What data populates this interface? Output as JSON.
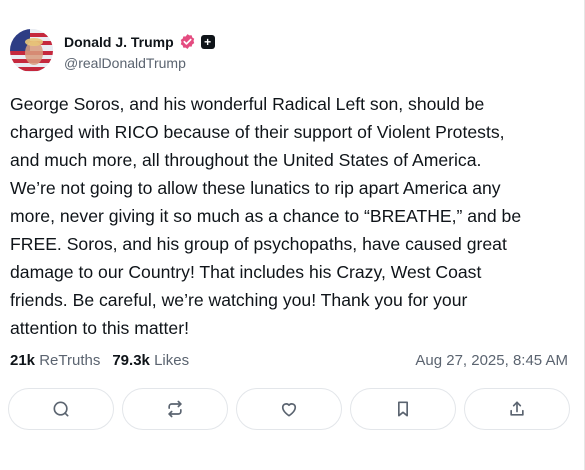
{
  "author": {
    "display_name": "Donald J. Trump",
    "handle": "@realDonaldTrump",
    "verified": true,
    "badge_icon": "plus-badge-icon",
    "badge_glyph": "+"
  },
  "post": {
    "text": "George Soros, and his wonderful Radical Left son, should be\ncharged with RICO because of their support of Violent Protests,\nand much more, all throughout the United States of America.\nWe’re not going to allow these lunatics to rip apart America any\nmore, never giving it so much as a chance to “BREATHE,” and be\nFREE. Soros, and his group of psychopaths, have caused great\ndamage to our Country! That includes his Crazy, West Coast\nfriends. Be careful, we’re watching you! Thank you for your\nattention to this matter!"
  },
  "stats": {
    "retruths_count": "21k",
    "retruths_label": "ReTruths",
    "likes_count": "79.3k",
    "likes_label": "Likes"
  },
  "timestamp": "Aug 27, 2025, 8:45 AM",
  "actions": [
    {
      "icon": "reply-icon"
    },
    {
      "icon": "retruth-icon"
    },
    {
      "icon": "like-icon"
    },
    {
      "icon": "bookmark-icon"
    },
    {
      "icon": "share-icon"
    }
  ],
  "colors": {
    "verified_badge": "#e44c80",
    "icon": "#5b6470",
    "border": "#e3e6ea"
  }
}
